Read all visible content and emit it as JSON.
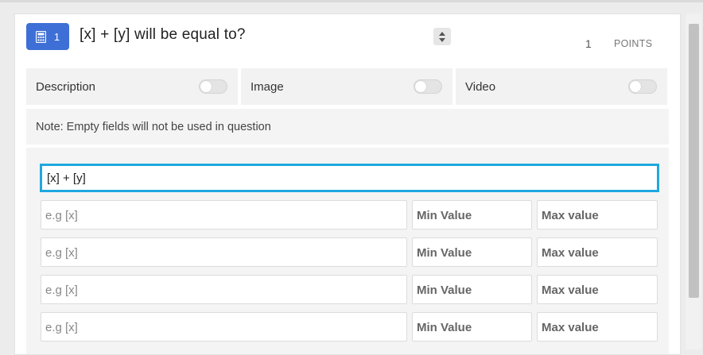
{
  "question": {
    "number": "1",
    "title": "[x] + [y] will be equal to?",
    "points_value": "1",
    "points_label": "POINTS"
  },
  "toggles": [
    {
      "label": "Description",
      "on": false
    },
    {
      "label": "Image",
      "on": false
    },
    {
      "label": "Video",
      "on": false
    }
  ],
  "note": "Note: Empty fields will not be used in question",
  "formula": "[x] + [y]",
  "variables": [
    {
      "name_placeholder": "e.g [x]",
      "min_placeholder": "Min Value",
      "max_placeholder": "Max value"
    },
    {
      "name_placeholder": "e.g [x]",
      "min_placeholder": "Min Value",
      "max_placeholder": "Max value"
    },
    {
      "name_placeholder": "e.g [x]",
      "min_placeholder": "Min Value",
      "max_placeholder": "Max value"
    },
    {
      "name_placeholder": "e.g [x]",
      "min_placeholder": "Min Value",
      "max_placeholder": "Max value"
    }
  ],
  "colors": {
    "badge": "#3d6fd6",
    "focus_border": "#1fa8e0",
    "panel_bg": "#f4f4f4"
  },
  "icons": [
    "calculator-icon",
    "sort-arrows-icon"
  ]
}
